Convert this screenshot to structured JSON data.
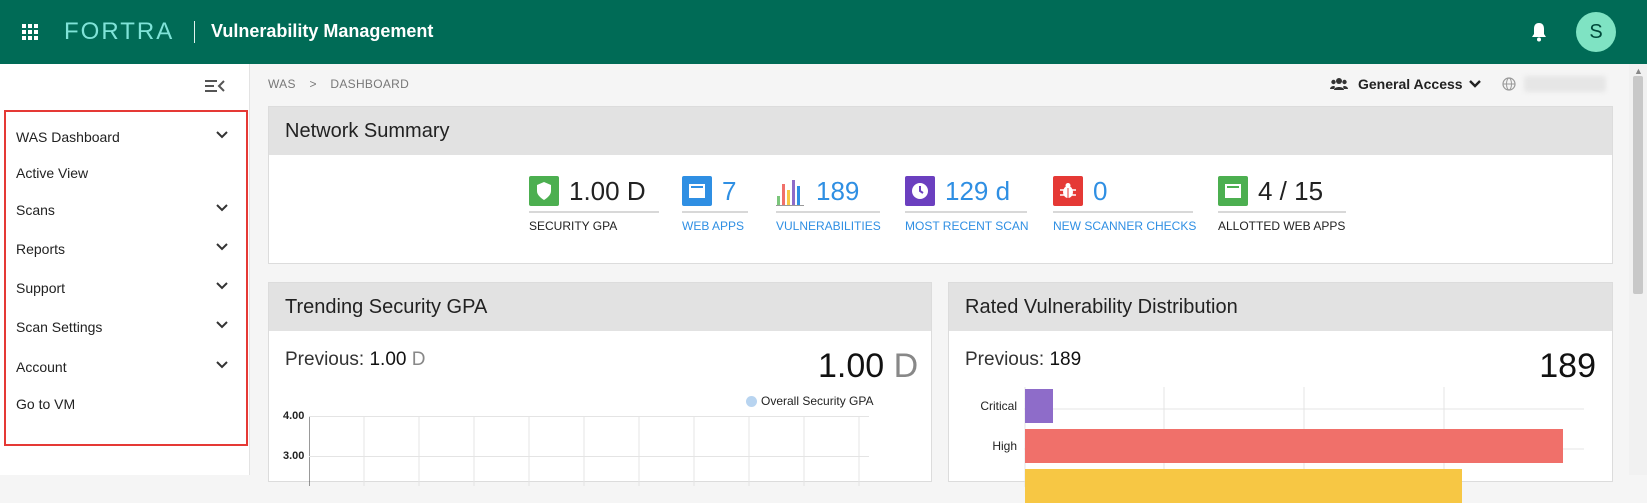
{
  "header": {
    "logo": "FORTRA",
    "app_title": "Vulnerability Management",
    "avatar_initial": "S"
  },
  "sidebar": {
    "items": [
      {
        "label": "WAS Dashboard",
        "expandable": true
      },
      {
        "label": "Active View",
        "expandable": false
      },
      {
        "label": "Scans",
        "expandable": true
      },
      {
        "label": "Reports",
        "expandable": true
      },
      {
        "label": "Support",
        "expandable": true
      },
      {
        "label": "Scan Settings",
        "expandable": true
      },
      {
        "label": "Account",
        "expandable": true
      },
      {
        "label": "Go to VM",
        "expandable": false
      }
    ]
  },
  "breadcrumb": [
    "WAS",
    ">",
    "DASHBOARD"
  ],
  "access": {
    "label": "General Access"
  },
  "network_summary": {
    "title": "Network Summary",
    "metrics": [
      {
        "value": "1.00 D",
        "label": "SECURITY GPA",
        "color": "#4caf50",
        "icon": "shield-icon",
        "link": false
      },
      {
        "value": "7",
        "label": "WEB APPS",
        "color": "#2f8fe3",
        "icon": "window-icon",
        "link": true
      },
      {
        "value": "189",
        "label": "VULNERABILITIES",
        "color": "",
        "icon": "bar-chart-icon",
        "link": true
      },
      {
        "value": "129 d",
        "label": "MOST RECENT SCAN",
        "color": "#6b3fbf",
        "icon": "clock-icon",
        "link": true
      },
      {
        "value": "0",
        "label": "NEW SCANNER CHECKS",
        "color": "#e53935",
        "icon": "bug-icon",
        "link": true
      },
      {
        "value": "4 / 15",
        "label": "ALLOTTED WEB APPS",
        "color": "#4caf50",
        "icon": "window-icon",
        "link": false
      }
    ]
  },
  "trending": {
    "title": "Trending Security GPA",
    "previous_label": "Previous:",
    "previous_value": "1.00",
    "previous_grade": "D",
    "current_value": "1.00",
    "current_grade": "D",
    "legend": "Overall Security GPA",
    "yticks": [
      "4.00",
      "3.00"
    ]
  },
  "distribution": {
    "title": "Rated Vulnerability Distribution",
    "previous_label": "Previous:",
    "previous_value": "189",
    "current_value": "189",
    "bars": [
      {
        "label": "Critical",
        "value": 5,
        "color": "#8e6cc9"
      },
      {
        "label": "High",
        "value": 96,
        "color": "#f0706a"
      },
      {
        "label": "",
        "value": 78,
        "color": "#f7c744"
      }
    ],
    "max": 100
  }
}
